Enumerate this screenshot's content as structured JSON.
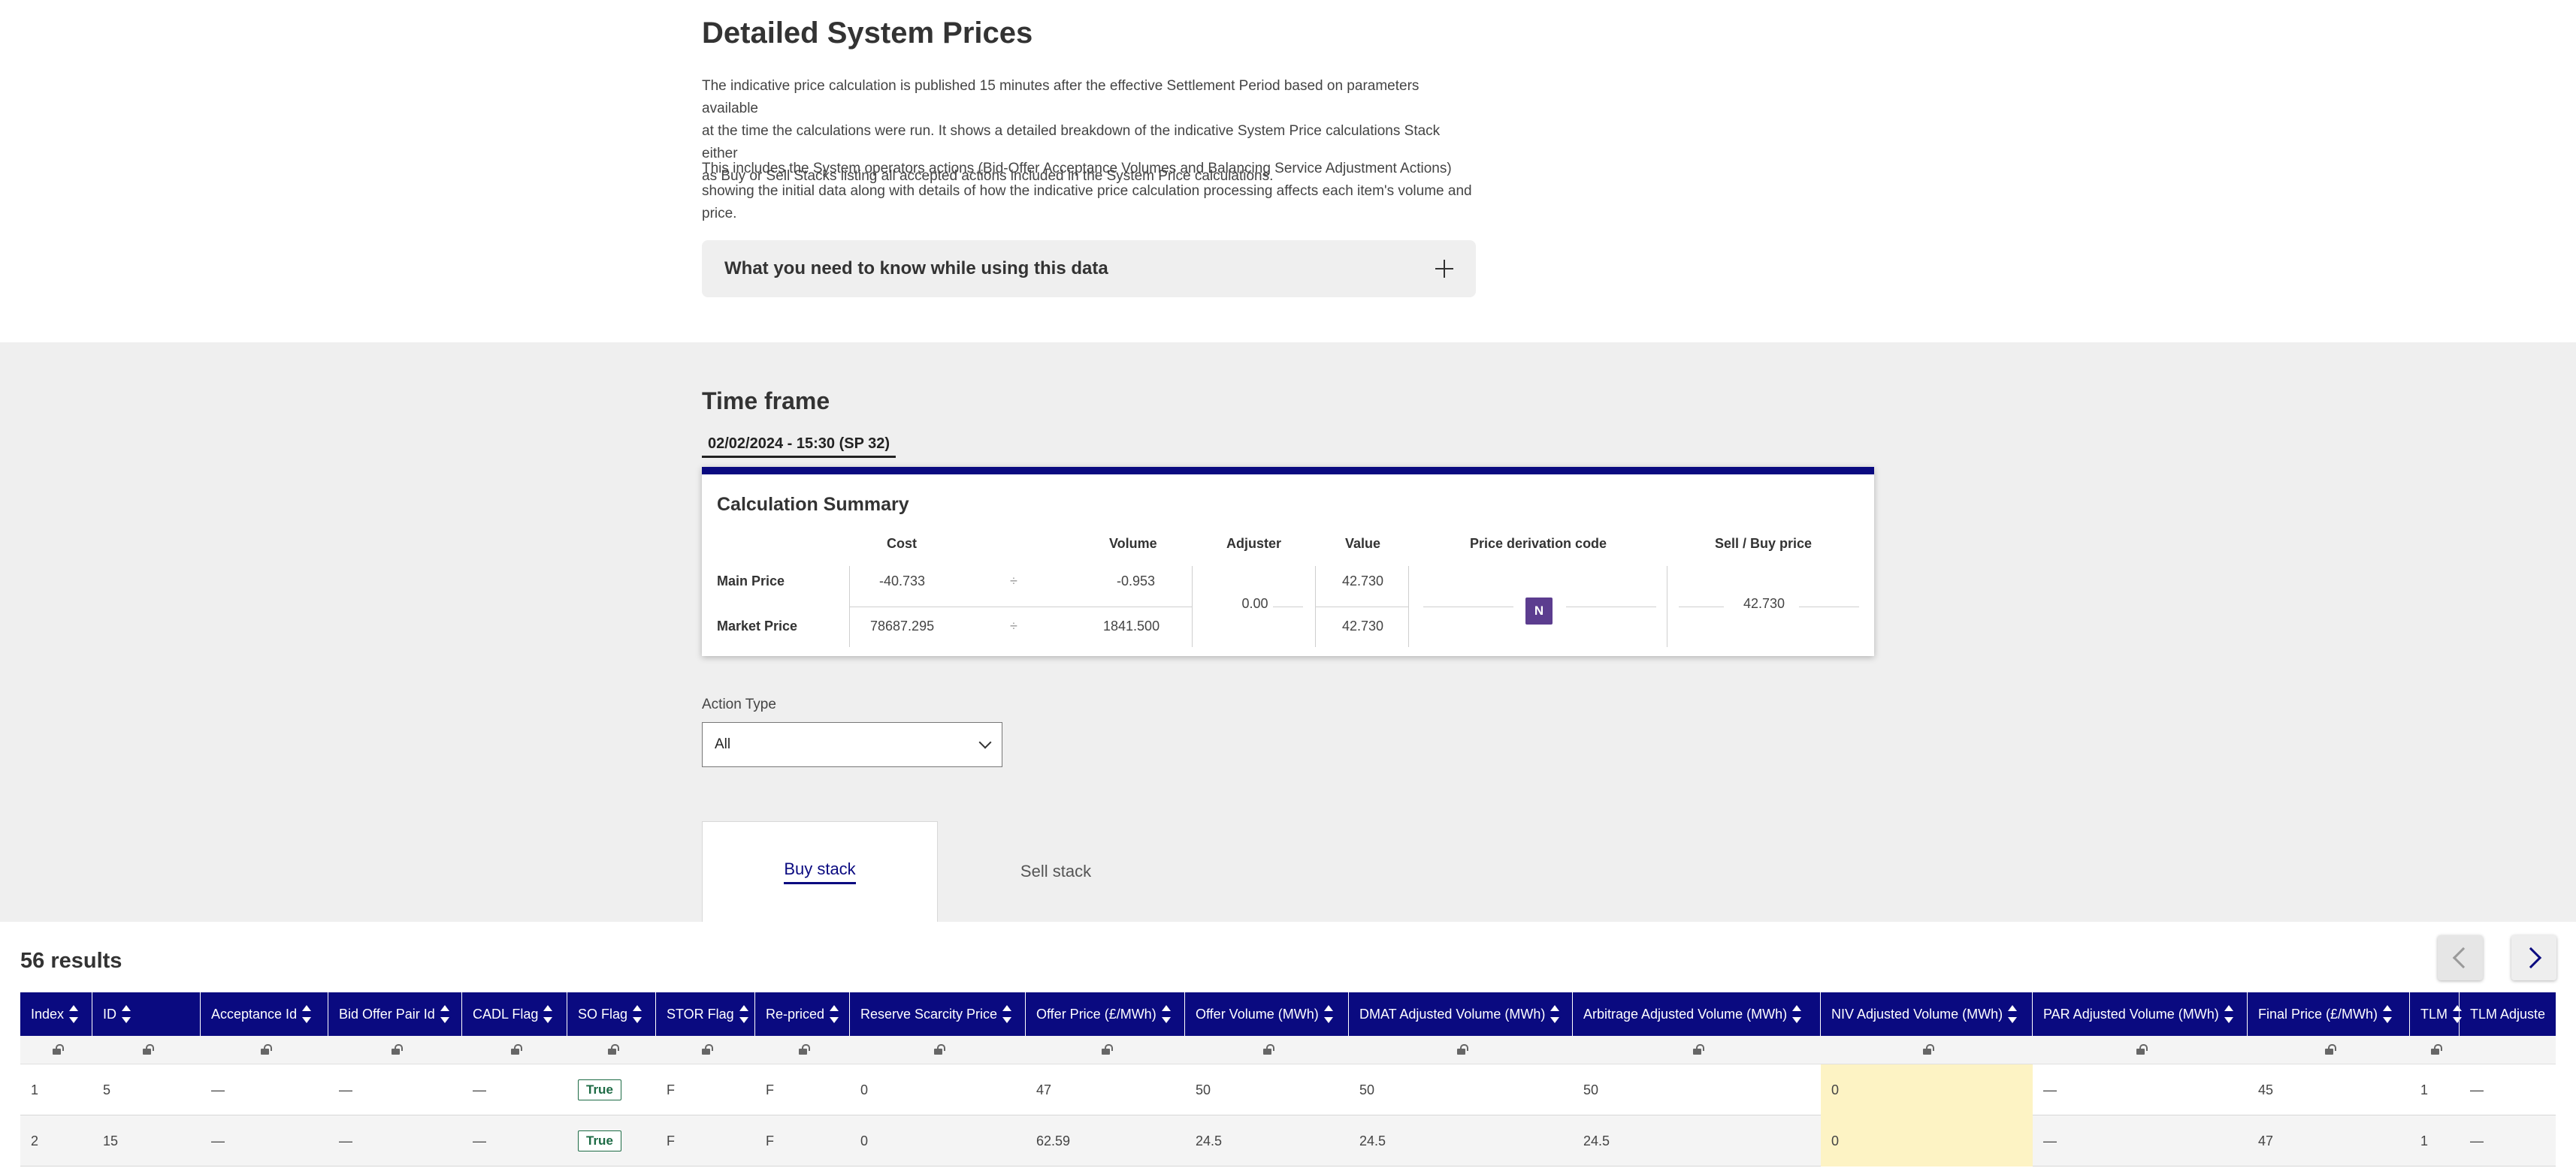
{
  "page": {
    "title": "Detailed System Prices",
    "para1": [
      "The indicative price calculation is published 15 minutes after the effective Settlement Period based on parameters available",
      "at the time the calculations were run. It shows a detailed breakdown of the indicative System Price calculations Stack either",
      "as Buy or Sell Stacks listing all accepted actions included in the System Price calculations."
    ],
    "para2": [
      "This includes the System operators actions (Bid-Offer Acceptance Volumes and Balancing Service Adjustment Actions)",
      "showing the initial data along with details of how the indicative price calculation processing affects each item's volume and",
      "price."
    ],
    "accordion": "What you need to know while using this data"
  },
  "timeframe": {
    "title": "Time frame",
    "value": "02/02/2024 - 15:30 (SP 32)"
  },
  "summary": {
    "title": "Calculation Summary",
    "headers": {
      "cost": "Cost",
      "volume": "Volume",
      "adjuster": "Adjuster",
      "value": "Value",
      "pdc": "Price derivation code",
      "sellbuy": "Sell / Buy price"
    },
    "main": {
      "label": "Main Price",
      "cost": "-40.733",
      "op": "÷",
      "volume": "-0.953",
      "value": "42.730"
    },
    "market": {
      "label": "Market Price",
      "cost": "78687.295",
      "op": "÷",
      "volume": "1841.500",
      "value": "42.730"
    },
    "adjuster": "0.00",
    "pdc": "N",
    "sellbuy": "42.730"
  },
  "filter": {
    "label": "Action Type",
    "selected": "All"
  },
  "tabs": {
    "buy": "Buy stack",
    "sell": "Sell stack"
  },
  "results": "56 results",
  "table": {
    "columns": [
      "Index",
      "ID",
      "Acceptance Id",
      "Bid Offer Pair Id",
      "CADL Flag",
      "SO Flag",
      "STOR Flag",
      "Re-priced",
      "Reserve Scarcity Price",
      "Offer Price (£/MWh)",
      "Offer Volume (MWh)",
      "DMAT Adjusted Volume (MWh)",
      "Arbitrage Adjusted Volume (MWh)",
      "NIV Adjusted Volume (MWh)",
      "PAR Adjusted Volume (MWh)",
      "Final Price (£/MWh)",
      "TLM",
      "TLM Adjuste"
    ],
    "rows": [
      [
        "1",
        "5",
        "—",
        "—",
        "—",
        "True",
        "F",
        "F",
        "0",
        "47",
        "50",
        "50",
        "50",
        "0",
        "—",
        "45",
        "1",
        "—"
      ],
      [
        "2",
        "15",
        "—",
        "—",
        "—",
        "True",
        "F",
        "F",
        "0",
        "62.59",
        "24.5",
        "24.5",
        "24.5",
        "0",
        "—",
        "47",
        "1",
        "—"
      ]
    ]
  },
  "colors": {
    "brand": "#0a0a80",
    "badge": "#5c3d8f",
    "true_badge": "#1d6b45",
    "highlight": "#fdf3c4"
  }
}
